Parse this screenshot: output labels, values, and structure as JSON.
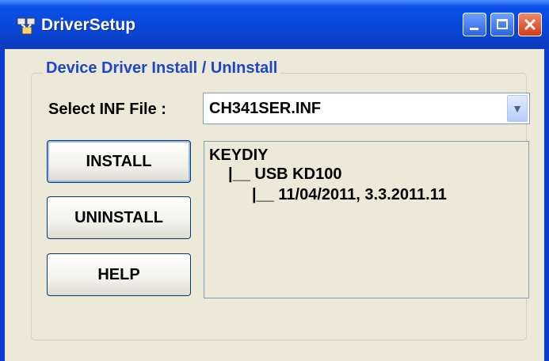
{
  "window": {
    "title": "DriverSetup"
  },
  "group": {
    "title": "Device Driver Install / UnInstall"
  },
  "inf": {
    "label": "Select INF File :",
    "selected": "CH341SER.INF"
  },
  "buttons": {
    "install": "INSTALL",
    "uninstall": "UNINSTALL",
    "help": "HELP"
  },
  "tree": {
    "manufacturer": "KEYDIY",
    "device": "|__ USB KD100",
    "version": "|__ 11/04/2011, 3.3.2011.11"
  },
  "icons": {
    "app": "driver-setup-icon",
    "minimize": "minimize-icon",
    "maximize": "maximize-icon",
    "close": "close-icon",
    "dropdown": "chevron-down-icon"
  }
}
